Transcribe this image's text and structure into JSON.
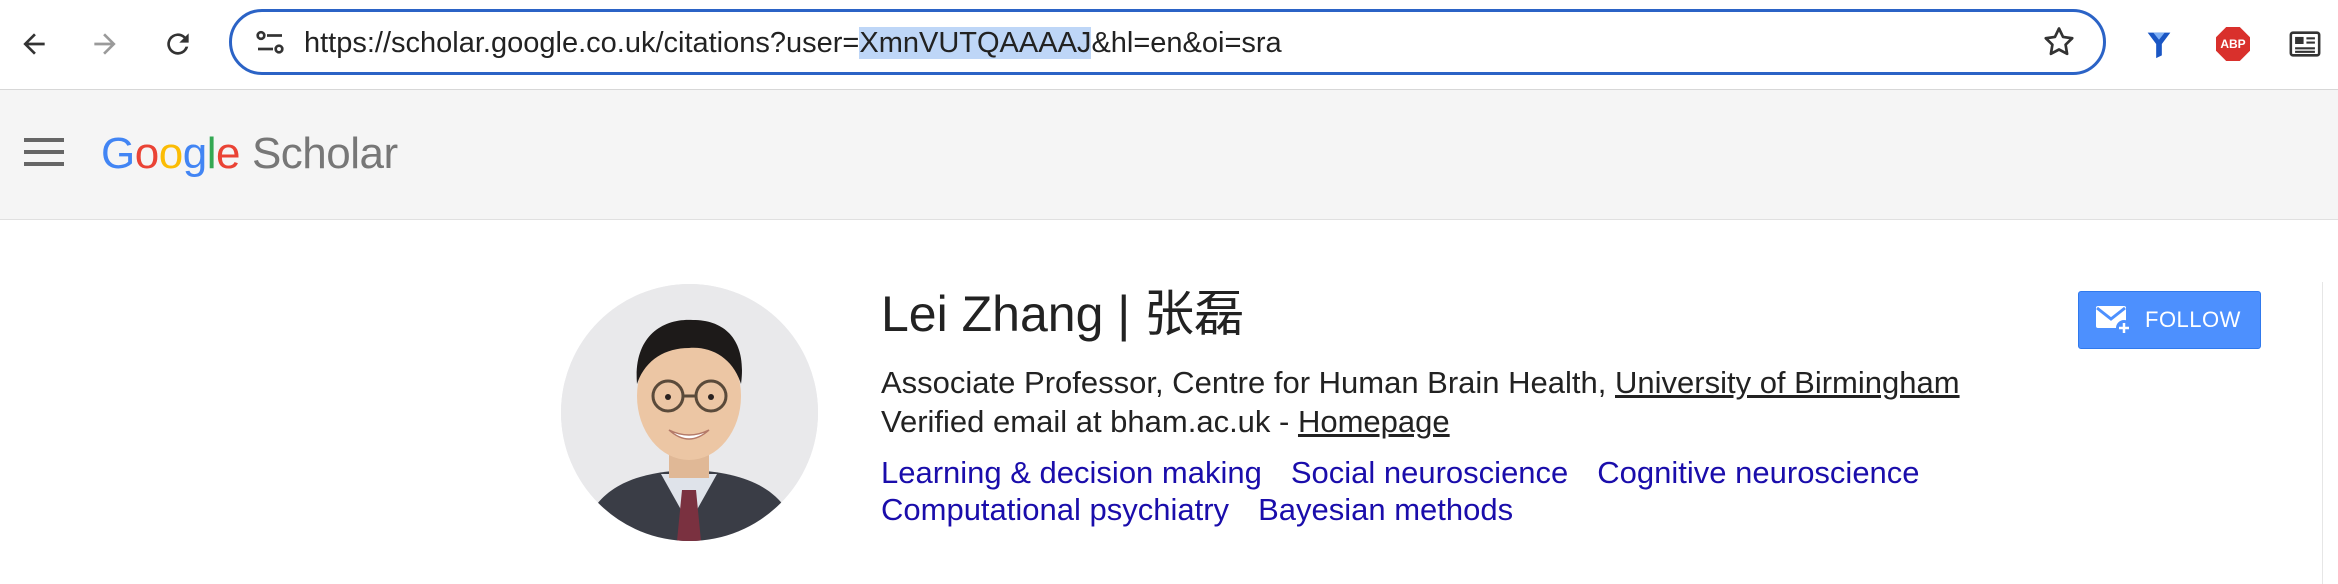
{
  "browser": {
    "url_prefix": "https://scholar.google.co.uk/citations?user=",
    "url_highlight": "XmnVUTQAAAAJ",
    "url_suffix": "&hl=en&oi=sra",
    "extensions": [
      "pin-extension-icon",
      "adblock-plus-icon",
      "reader-view-icon"
    ],
    "abp_label": "ABP"
  },
  "header": {
    "logo_letters": [
      "G",
      "o",
      "o",
      "g",
      "l",
      "e"
    ],
    "logo_colors": [
      "#4285f4",
      "#ea4335",
      "#fbbc05",
      "#4285f4",
      "#34a853",
      "#ea4335"
    ],
    "logo_product": "Scholar"
  },
  "profile": {
    "name": "Lei Zhang | 张磊",
    "affiliation_prefix": "Associate Professor, Centre for Human Brain Health, ",
    "affiliation_link": "University of Birmingham",
    "email_prefix": "Verified email at bham.ac.uk - ",
    "homepage_label": "Homepage",
    "interests": [
      "Learning & decision making",
      "Social neuroscience",
      "Cognitive neuroscience",
      "Computational psychiatry",
      "Bayesian methods"
    ],
    "follow_label": "FOLLOW"
  },
  "colors": {
    "accent": "#2b63c6",
    "link": "#1a0dab",
    "follow_button": "#4d90fe"
  }
}
